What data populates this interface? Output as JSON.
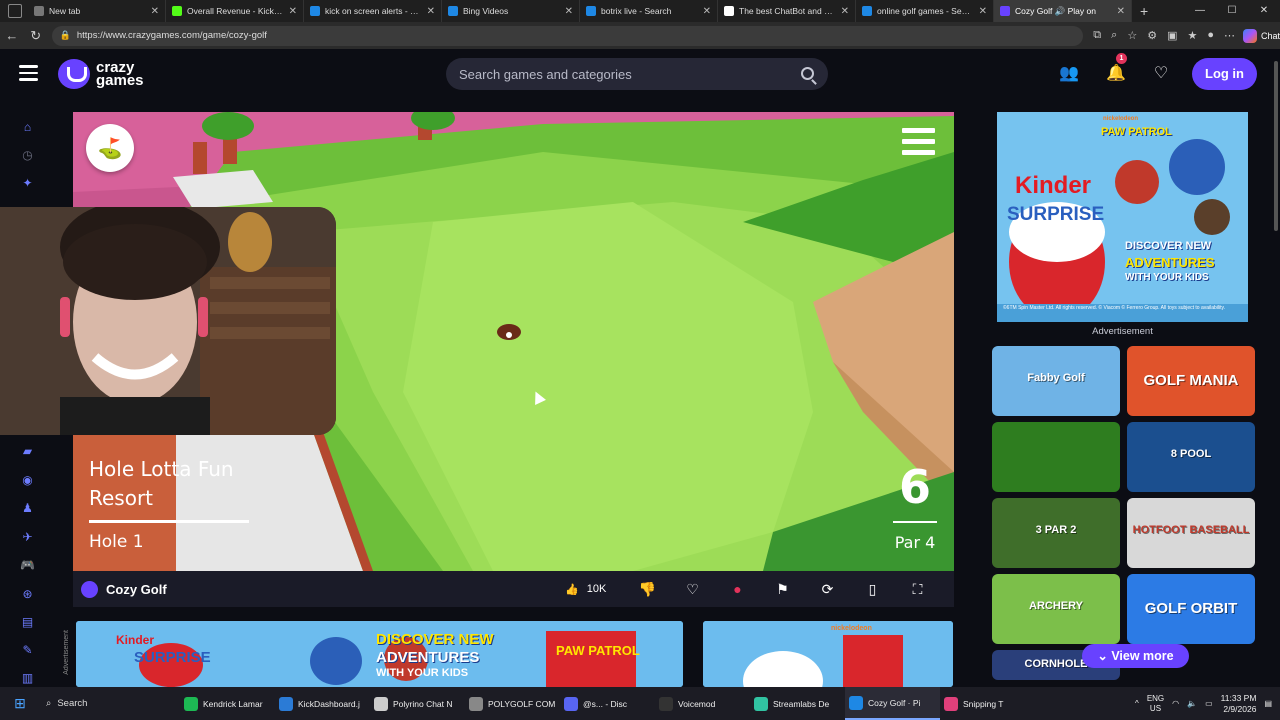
{
  "browser": {
    "tabs": [
      {
        "title": "New tab",
        "color": "#777777"
      },
      {
        "title": "Overall Revenue - Kick Dash",
        "color": "#53fc18"
      },
      {
        "title": "kick on screen alerts - Search",
        "color": "#1e88e5"
      },
      {
        "title": "Bing Videos",
        "color": "#1e88e5"
      },
      {
        "title": "botrix live - Search",
        "color": "#1e88e5"
      },
      {
        "title": "The best ChatBot and Widge",
        "color": "#ffffff"
      },
      {
        "title": "online golf games - Search",
        "color": "#1e88e5"
      },
      {
        "title": "Cozy Golf 🔊 Play on",
        "color": "#6842ff",
        "active": true
      }
    ],
    "url": "https://www.crazygames.com/game/cozy-golf",
    "chat_label": "Chat"
  },
  "header": {
    "logo_line1": "crazy",
    "logo_line2": "games",
    "search_placeholder": "Search games and categories",
    "notification_count": "1",
    "login_label": "Log in"
  },
  "game": {
    "course_name": "Hole Lotta Fun Resort",
    "hole_label": "Hole 1",
    "par_number": "6",
    "par_label": "Par 4",
    "name": "Cozy Golf",
    "likes": "10K"
  },
  "sidebar_ad_label": "Advertisement",
  "bottom_ad_vertical_label": "Advertisement",
  "ad_texts": {
    "brand": "Kinder",
    "product": "SURPRISE",
    "slogan1": "DISCOVER NEW",
    "slogan2": "ADVENTURES",
    "slogan3": "WITH YOUR KIDS",
    "paw": "PAW PATROL",
    "nick": "nickelodeon",
    "legal": "©6TM Spin Master Ltd. All rights reserved. © Viacom © Ferrero Group. All toys subject to availability."
  },
  "thumbnails": [
    {
      "title": "Fabby Golf",
      "bg": "#6fb3e6"
    },
    {
      "title": "GOLF MANIA",
      "bg": "#e0532b"
    },
    {
      "title": "",
      "bg": "#2e7d1f"
    },
    {
      "title": "8 POOL",
      "bg": "#1b4f8f"
    },
    {
      "title": "3 PAR 2",
      "bg": "#3f6e2a"
    },
    {
      "title": "HOTFOOT BASEBALL",
      "bg": "#d8d8d8"
    },
    {
      "title": "ARCHERY",
      "bg": "#7cbf4a"
    },
    {
      "title": "GOLF ORBIT",
      "bg": "#2c7be5"
    },
    {
      "title": "CORNHOLE",
      "bg": "#2a3f7a"
    }
  ],
  "view_more_label": "View more",
  "taskbar": {
    "search_label": "Search",
    "items": [
      {
        "label": "Kendrick Lamar",
        "color": "#1db954"
      },
      {
        "label": "KickDashboard.j",
        "color": "#2b7bd6"
      },
      {
        "label": "Polyrino Chat N",
        "color": "#cccccc"
      },
      {
        "label": "POLYGOLF COM",
        "color": "#888888"
      },
      {
        "label": "@s... - Disc",
        "color": "#5865f2"
      },
      {
        "label": "Voicemod",
        "color": "#333333"
      },
      {
        "label": "Streamlabs De",
        "color": "#31c3a2"
      },
      {
        "label": "Cozy Golf · Pi",
        "color": "#1e88e5",
        "active": true
      },
      {
        "label": "Snipping T",
        "color": "#e0407b"
      }
    ],
    "lang1": "ENG",
    "lang2": "US",
    "time": "11:33 PM",
    "date": "2/9/2026"
  }
}
